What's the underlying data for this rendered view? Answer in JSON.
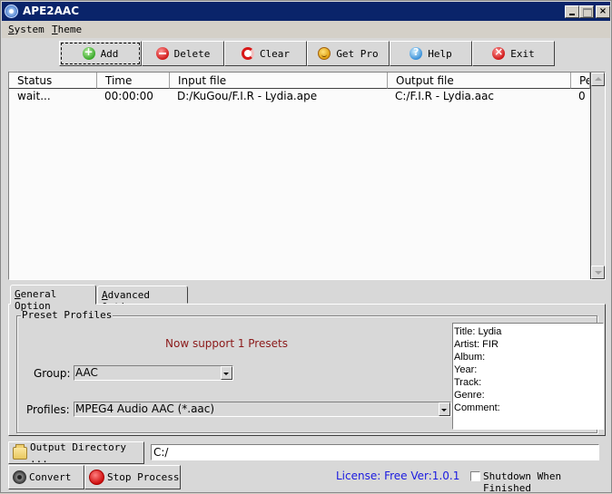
{
  "window": {
    "title": "APE2AAC",
    "controls": {
      "minimize": "_",
      "maximize": "□",
      "close": "×"
    }
  },
  "menu": [
    {
      "label": "System",
      "accel": "S",
      "rest": "ystem"
    },
    {
      "label": "Theme",
      "accel": "T",
      "rest": "heme"
    }
  ],
  "toolbar": [
    {
      "label": "Add",
      "icon": "add-icon"
    },
    {
      "label": "Delete",
      "icon": "delete-icon"
    },
    {
      "label": "Clear",
      "icon": "clear-icon"
    },
    {
      "label": "Get Pro",
      "icon": "smiley-icon"
    },
    {
      "label": "Help",
      "icon": "help-icon"
    },
    {
      "label": "Exit",
      "icon": "exit-icon"
    }
  ],
  "list": {
    "columns": [
      "Status",
      "Time",
      "Input file",
      "Output file",
      "Pe"
    ],
    "rows": [
      {
        "status": "wait...",
        "time": "00:00:00",
        "input": "D:/KuGou/F.I.R - Lydia.ape",
        "output": "C:/F.I.R - Lydia.aac",
        "percent": "0"
      }
    ]
  },
  "tabs": [
    {
      "accel": "G",
      "rest": "eneral Option",
      "selected": true
    },
    {
      "accel": "A",
      "rest": "dvanced Option",
      "selected": false
    }
  ],
  "presets": {
    "group_label": "Preset Profiles",
    "note": "Now support 1 Presets",
    "group_field_label": "Group:",
    "group_value": "AAC",
    "profiles_field_label": "Profiles:",
    "profiles_value": "MPEG4 Audio AAC (*.aac)"
  },
  "tags": [
    "Title:   Lydia",
    "Artist:  FIR",
    "Album:",
    "Year:",
    "Track:",
    "Genre:",
    "Comment:"
  ],
  "bottom": {
    "output_dir_button": "Output Directory ...",
    "output_dir_value": "C:/",
    "convert_button": "Convert",
    "stop_button": "Stop Process",
    "license": "License: Free Ver:1.0.1",
    "shutdown_label": "Shutdown When Finished",
    "shutdown_checked": false
  }
}
